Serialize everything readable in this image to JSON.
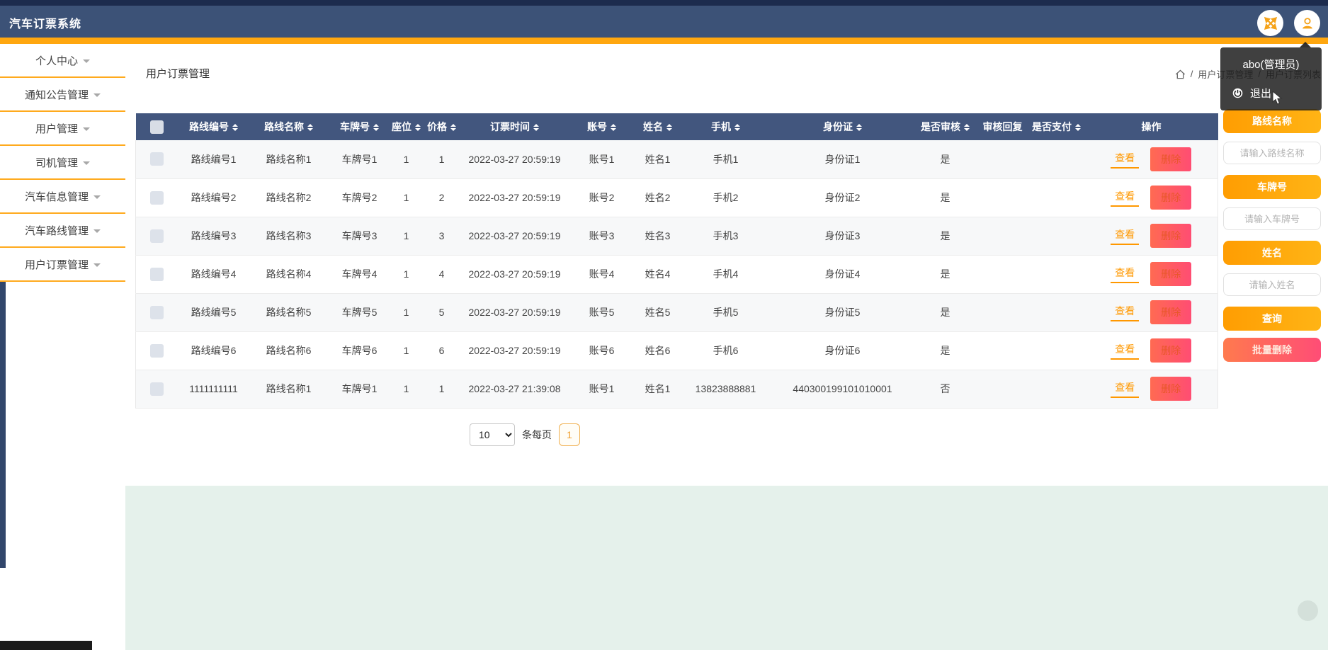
{
  "app": {
    "title": "汽车订票系统"
  },
  "navbar": {
    "icons": {
      "fullscreen": "fullscreen-arrows-icon",
      "avatar": "person-icon"
    },
    "user_menu": {
      "name": "abo(管理员)",
      "logout_label": "退出",
      "logout_icon": "power-icon"
    }
  },
  "sidebar": {
    "items": [
      {
        "label": "个人中心"
      },
      {
        "label": "通知公告管理"
      },
      {
        "label": "用户管理"
      },
      {
        "label": "司机管理"
      },
      {
        "label": "汽车信息管理"
      },
      {
        "label": "汽车路线管理"
      },
      {
        "label": "用户订票管理"
      }
    ]
  },
  "main": {
    "page_title": "用户订票管理",
    "breadcrumb": {
      "home_icon": "home-icon",
      "separator": "/",
      "parts": [
        "用户订票管理",
        "用户订票列表"
      ]
    },
    "table": {
      "columns": [
        {
          "key": "route_no",
          "label": "路线编号",
          "sortable": true
        },
        {
          "key": "route_name",
          "label": "路线名称",
          "sortable": true
        },
        {
          "key": "plate_no",
          "label": "车牌号",
          "sortable": true
        },
        {
          "key": "seats",
          "label": "座位",
          "sortable": true
        },
        {
          "key": "price",
          "label": "价格",
          "sortable": true
        },
        {
          "key": "book_time",
          "label": "订票时间",
          "sortable": true
        },
        {
          "key": "account",
          "label": "账号",
          "sortable": true
        },
        {
          "key": "name",
          "label": "姓名",
          "sortable": true
        },
        {
          "key": "phone",
          "label": "手机",
          "sortable": true
        },
        {
          "key": "id_card",
          "label": "身份证",
          "sortable": true
        },
        {
          "key": "audited",
          "label": "是否审核",
          "sortable": true
        },
        {
          "key": "audit_reply",
          "label": "审核回复",
          "sortable": false
        },
        {
          "key": "paid",
          "label": "是否支付",
          "sortable": true
        },
        {
          "key": "ops",
          "label": "操作",
          "sortable": false
        }
      ],
      "rows": [
        {
          "route_no": "路线编号1",
          "route_name": "路线名称1",
          "plate_no": "车牌号1",
          "seats": "1",
          "price": "1",
          "book_time": "2022-03-27 20:59:19",
          "account": "账号1",
          "name": "姓名1",
          "phone": "手机1",
          "id_card": "身份证1",
          "audited": "是",
          "audit_reply": "",
          "paid": ""
        },
        {
          "route_no": "路线编号2",
          "route_name": "路线名称2",
          "plate_no": "车牌号2",
          "seats": "1",
          "price": "2",
          "book_time": "2022-03-27 20:59:19",
          "account": "账号2",
          "name": "姓名2",
          "phone": "手机2",
          "id_card": "身份证2",
          "audited": "是",
          "audit_reply": "",
          "paid": ""
        },
        {
          "route_no": "路线编号3",
          "route_name": "路线名称3",
          "plate_no": "车牌号3",
          "seats": "1",
          "price": "3",
          "book_time": "2022-03-27 20:59:19",
          "account": "账号3",
          "name": "姓名3",
          "phone": "手机3",
          "id_card": "身份证3",
          "audited": "是",
          "audit_reply": "",
          "paid": ""
        },
        {
          "route_no": "路线编号4",
          "route_name": "路线名称4",
          "plate_no": "车牌号4",
          "seats": "1",
          "price": "4",
          "book_time": "2022-03-27 20:59:19",
          "account": "账号4",
          "name": "姓名4",
          "phone": "手机4",
          "id_card": "身份证4",
          "audited": "是",
          "audit_reply": "",
          "paid": ""
        },
        {
          "route_no": "路线编号5",
          "route_name": "路线名称5",
          "plate_no": "车牌号5",
          "seats": "1",
          "price": "5",
          "book_time": "2022-03-27 20:59:19",
          "account": "账号5",
          "name": "姓名5",
          "phone": "手机5",
          "id_card": "身份证5",
          "audited": "是",
          "audit_reply": "",
          "paid": ""
        },
        {
          "route_no": "路线编号6",
          "route_name": "路线名称6",
          "plate_no": "车牌号6",
          "seats": "1",
          "price": "6",
          "book_time": "2022-03-27 20:59:19",
          "account": "账号6",
          "name": "姓名6",
          "phone": "手机6",
          "id_card": "身份证6",
          "audited": "是",
          "audit_reply": "",
          "paid": ""
        },
        {
          "route_no": "1111111111",
          "route_name": "路线名称1",
          "plate_no": "车牌号1",
          "seats": "1",
          "price": "1",
          "book_time": "2022-03-27 21:39:08",
          "account": "账号1",
          "name": "姓名1",
          "phone": "13823888881",
          "id_card": "440300199101010001",
          "audited": "否",
          "audit_reply": "",
          "paid": ""
        }
      ],
      "actions": {
        "view": "查看",
        "delete": "删除"
      }
    },
    "pagination": {
      "page_size": "10",
      "per_page_label": "条每页",
      "current_page": "1"
    },
    "filters": [
      {
        "label": "路线名称",
        "placeholder": "请输入路线名称"
      },
      {
        "label": "车牌号",
        "placeholder": "请输入车牌号"
      },
      {
        "label": "姓名",
        "placeholder": "请输入姓名"
      }
    ],
    "filter_actions": {
      "search": "查询",
      "batch_delete": "批量删除"
    }
  },
  "colors": {
    "accent_orange": "#ffa70f",
    "navbar_bg": "#3c5277",
    "table_header_bg": "#42567e",
    "danger_gradient": [
      "#ff7a4e",
      "#ff4d76"
    ],
    "button_gradient": [
      "#ff9d02",
      "#ffb415"
    ],
    "view_link": "#ff9800",
    "footer_mint": "#e5f1eb"
  }
}
